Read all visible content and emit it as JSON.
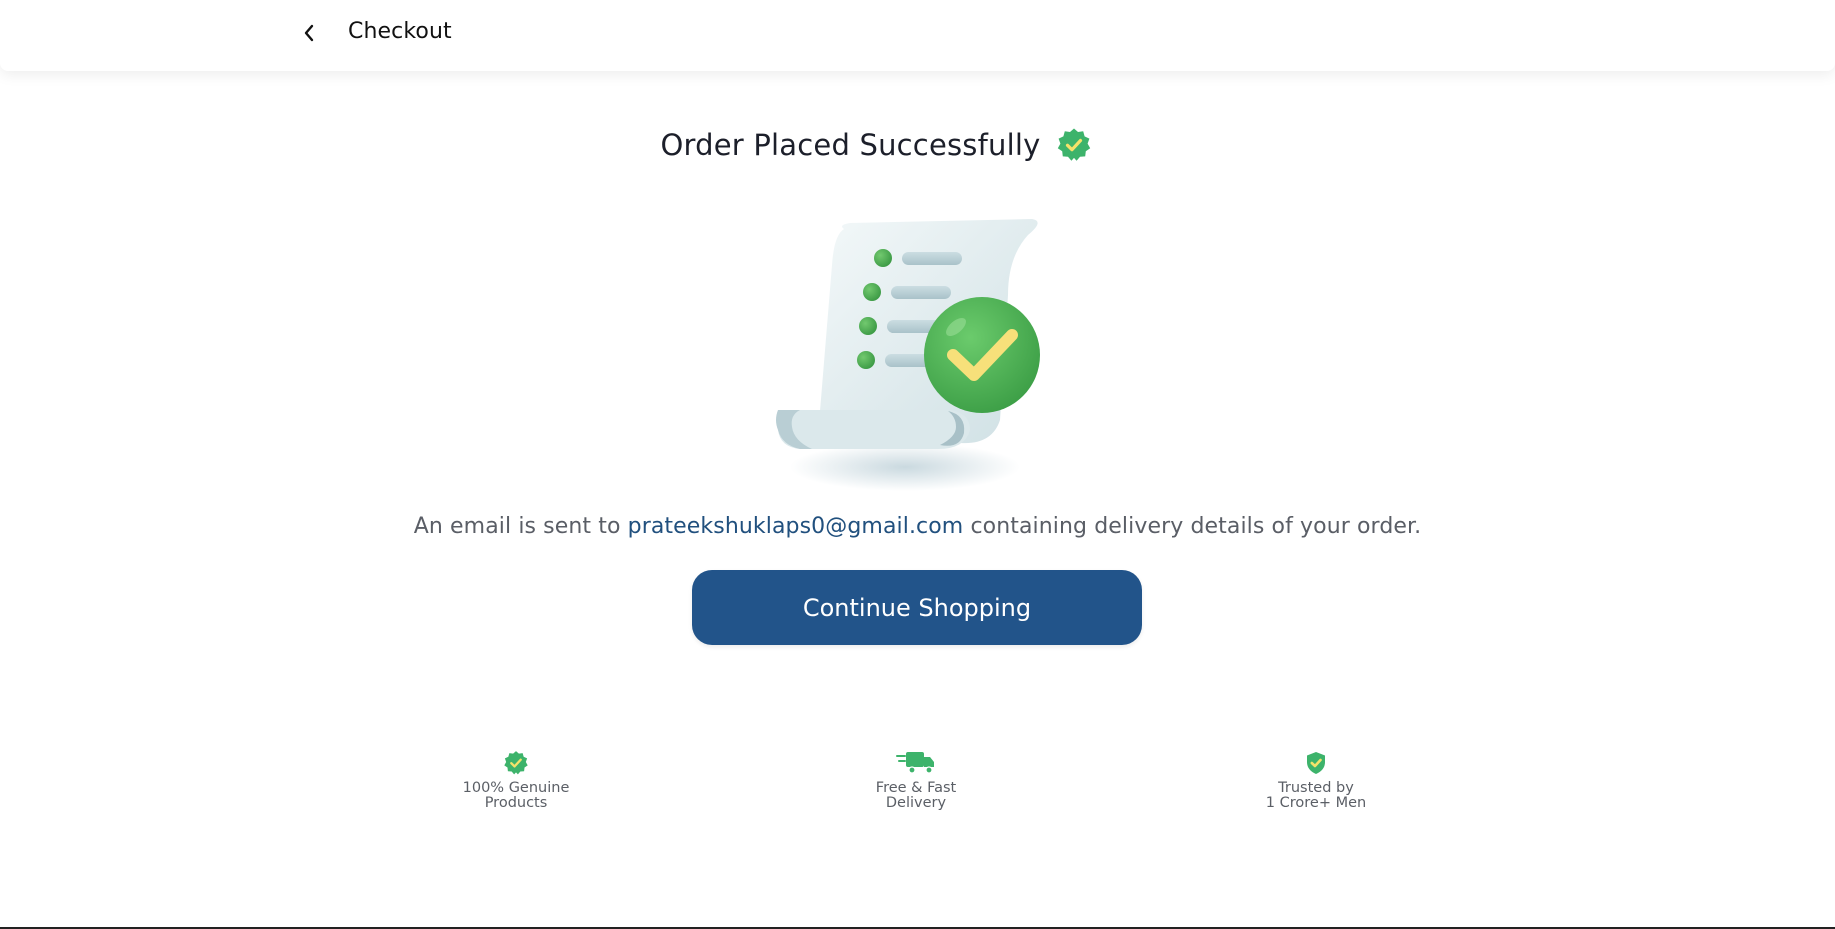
{
  "header": {
    "back_icon": "chevron-left-icon",
    "title": "Checkout"
  },
  "main": {
    "title": "Order Placed Successfully",
    "title_icon": "verified-badge-icon",
    "illustration": "receipt-checkmark-illustration",
    "message": {
      "before": "An email is sent to",
      "email": "prateekshuklaps0@gmail.com",
      "after": "containing delivery details of your order."
    },
    "cta_label": "Continue Shopping"
  },
  "features": [
    {
      "icon": "verified-badge-icon",
      "line1": "100% Genuine",
      "line2": "Products"
    },
    {
      "icon": "delivery-truck-icon",
      "line1": "Free & Fast",
      "line2": "Delivery"
    },
    {
      "icon": "shield-check-icon",
      "line1": "Trusted by",
      "line2": "1 Crore+ Men"
    }
  ],
  "colors": {
    "primary": "#22548a",
    "accent_green": "#3db36b",
    "email_link": "#21507e"
  }
}
